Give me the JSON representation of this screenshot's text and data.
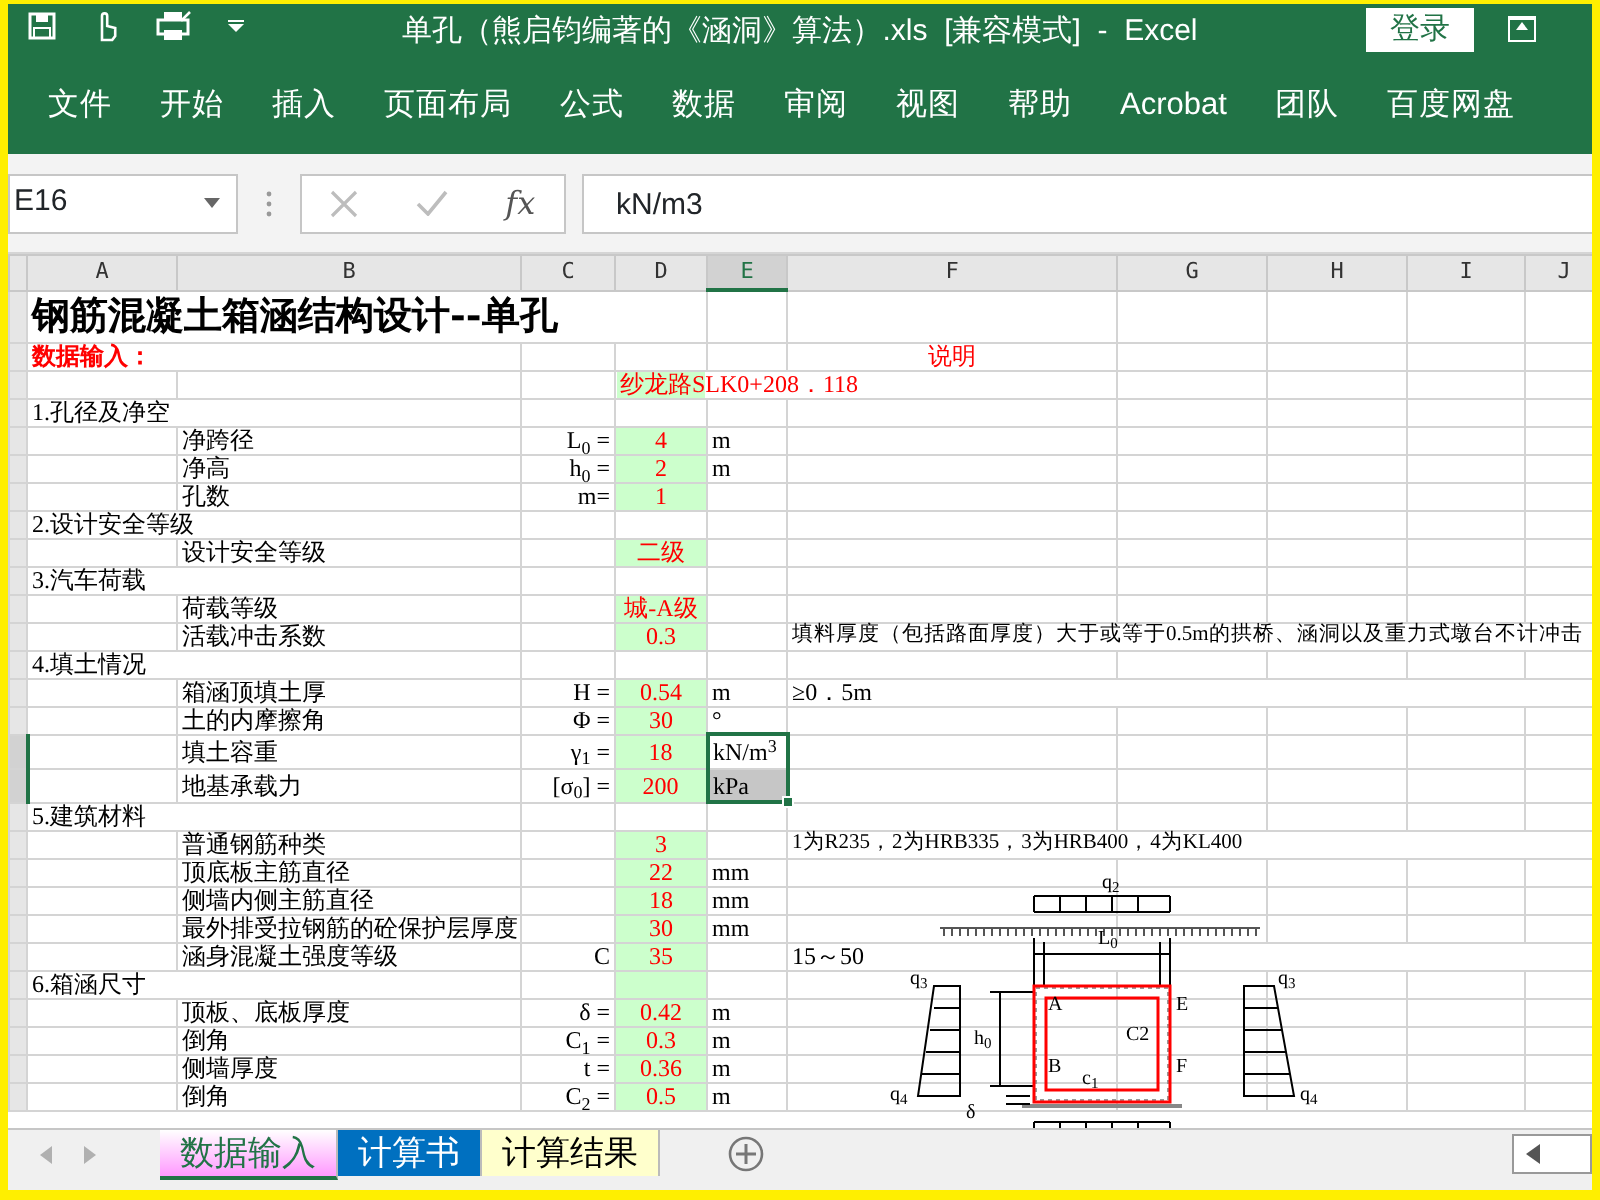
{
  "window": {
    "title": "单孔（熊启钧编著的《涵洞》算法）.xls  [兼容模式]  -  Excel",
    "login": "登录"
  },
  "ribbon_tabs": [
    "文件",
    "开始",
    "插入",
    "页面布局",
    "公式",
    "数据",
    "审阅",
    "视图",
    "帮助",
    "Acrobat",
    "团队",
    "百度网盘"
  ],
  "formula_bar": {
    "name_box": "E16",
    "function_label": "fx",
    "value": "kN/m3"
  },
  "sheet": {
    "columns": [
      {
        "label": "A",
        "selected": false
      },
      {
        "label": "B",
        "selected": false
      },
      {
        "label": "C",
        "selected": false
      },
      {
        "label": "D",
        "selected": false
      },
      {
        "label": "E",
        "selected": true
      },
      {
        "label": "F",
        "selected": false
      },
      {
        "label": "G",
        "selected": false
      },
      {
        "label": "H",
        "selected": false
      },
      {
        "label": "I",
        "selected": false
      },
      {
        "label": "J",
        "selected": false
      }
    ],
    "rows": [
      {
        "kind": "title",
        "a": "钢筋混凝土箱涵结构设计--单孔",
        "input": false,
        "selected": false
      },
      {
        "kind": "header",
        "a": "数据输入：",
        "f": "说明",
        "input": false,
        "selected": false
      },
      {
        "kind": "station",
        "d": "纱龙路SLK0+208．118",
        "input": true,
        "selected": false
      },
      {
        "kind": "section",
        "a": "1.孔径及净空",
        "input": false,
        "selected": false
      },
      {
        "kind": "param",
        "b": "净跨径",
        "c": "L$_{0}$ =",
        "d": "4",
        "e": "m",
        "input": true,
        "selected": false
      },
      {
        "kind": "param",
        "b": "净高",
        "c": "h$_{0}$ =",
        "d": "2",
        "e": "m",
        "input": true,
        "selected": false
      },
      {
        "kind": "param",
        "b": "孔数",
        "c": "m=",
        "d": "1",
        "input": true,
        "selected": false
      },
      {
        "kind": "section",
        "a": "2.设计安全等级",
        "input": false,
        "selected": false
      },
      {
        "kind": "param",
        "b": "设计安全等级",
        "d": "二级",
        "input": true,
        "selected": false
      },
      {
        "kind": "section",
        "a": "3.汽车荷载",
        "input": false,
        "selected": false
      },
      {
        "kind": "param",
        "b": "荷载等级",
        "d": "城-A级",
        "input": true,
        "selected": false
      },
      {
        "kind": "param",
        "b": "活载冲击系数",
        "d": "0.3",
        "f": "填料厚度（包括路面厚度）大于或等于0.5m的拱桥、涵洞以及重力式墩台不计冲击",
        "input": true,
        "selected": false
      },
      {
        "kind": "section",
        "a": "4.填土情况",
        "input": false,
        "selected": false
      },
      {
        "kind": "param",
        "b": "箱涵顶填土厚",
        "c": "H =",
        "d": "0.54",
        "e": "m",
        "f": "≥0．5m",
        "input": true,
        "selected": false
      },
      {
        "kind": "param",
        "b": "土的内摩擦角",
        "c": "Φ =",
        "d": "30",
        "e": "°",
        "input": true,
        "selected": false
      },
      {
        "kind": "param",
        "b": "填土容重",
        "c": "γ$_{1}$ =",
        "d": "18",
        "e": "kN/m$^{3}$",
        "input": true,
        "selected": true
      },
      {
        "kind": "param",
        "b": "地基承载力",
        "c": "[σ$_{0}$] =",
        "d": "200",
        "e": "kPa",
        "input": true,
        "selected": true
      },
      {
        "kind": "section",
        "a": "5.建筑材料",
        "input": false,
        "selected": false
      },
      {
        "kind": "param",
        "b": "普通钢筋种类",
        "d": "3",
        "f": "1为R235，2为HRB335，3为HRB400，4为KL400",
        "input": true,
        "selected": false
      },
      {
        "kind": "param",
        "b": "顶底板主筋直径",
        "d": "22",
        "e": "mm",
        "input": true,
        "selected": false
      },
      {
        "kind": "param",
        "b": "侧墙内侧主筋直径",
        "d": "18",
        "e": "mm",
        "input": true,
        "selected": false
      },
      {
        "kind": "param",
        "b": "最外排受拉钢筋的砼保护层厚度",
        "d": "30",
        "e": "mm",
        "input": true,
        "selected": false
      },
      {
        "kind": "param",
        "b": "涵身混凝土强度等级",
        "c": "C",
        "d": "35",
        "f": "15～50",
        "input": true,
        "selected": false
      },
      {
        "kind": "section",
        "a": "6.箱涵尺寸",
        "input": true,
        "selected": false
      },
      {
        "kind": "param",
        "b": "顶板、底板厚度",
        "c": "δ =",
        "d": "0.42",
        "e": "m",
        "input": true,
        "selected": false
      },
      {
        "kind": "param",
        "b": "倒角",
        "c": "C$_{1}$ =",
        "d": "0.3",
        "e": "m",
        "input": true,
        "selected": false
      },
      {
        "kind": "param",
        "b": "侧墙厚度",
        "c": "t =",
        "d": "0.36",
        "e": "m",
        "input": true,
        "selected": false
      },
      {
        "kind": "param",
        "b": "倒角",
        "c": "C$_{2}$ =",
        "d": "0.5",
        "e": "m",
        "input": true,
        "selected": false
      }
    ]
  },
  "diagram": {
    "labels": [
      "q$_{2}$",
      "L$_{0}$",
      "q$_{3}$",
      "q$_{3}$",
      "h$_{0}$",
      "A",
      "E",
      "C2",
      "B",
      "F",
      "c$_{1}$",
      "q$_{4}$",
      "q$_{4}$",
      "δ"
    ]
  },
  "sheet_tabs": [
    {
      "label": "数据输入",
      "color": "#ff99ff",
      "selected": true
    },
    {
      "label": "计算书",
      "color": "#0070c0",
      "selected": false
    },
    {
      "label": "计算结果",
      "color": "#ffffcc",
      "selected": false
    }
  ]
}
